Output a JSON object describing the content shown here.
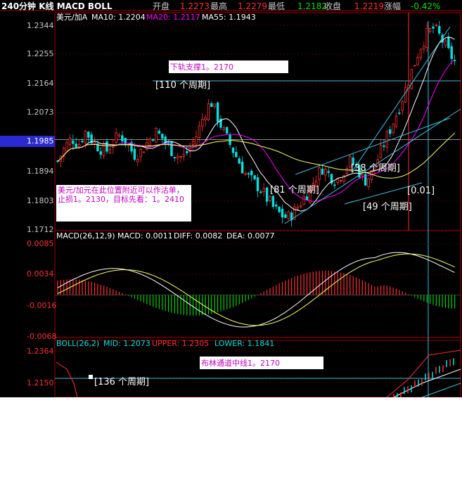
{
  "header": {
    "period": "240分钟",
    "kline_label": "K线",
    "indicators": "MACD BOLL",
    "open_label": "开盘",
    "open_value": "1.2273",
    "high_label": "最高",
    "high_value": "1.2279",
    "low_label": "最低",
    "low_value": "1.2182",
    "close_label": "收盘",
    "close_value": "1.2219",
    "change_label": "涨幅",
    "change_value": "-0.42%"
  },
  "main_panel": {
    "symbol": "美元/加A",
    "ma10": "MA10: 1.2204",
    "ma20": "MA20: 1.2117",
    "ma55": "MA55: 1.1943",
    "price_ticks": [
      "1.2344",
      "1.2255",
      "1.2164",
      "1.2073",
      "1.1985",
      "1.1894",
      "1.1803",
      "1.1712"
    ],
    "current_price": "1.1985",
    "note_support": "下轨支撑1。2170",
    "note_main": "美元/加元在此位置附近可以作沽单，止损1。2130，目标先看：1。2410",
    "labels": [
      "[110 个周期]",
      "[81 个周期]",
      "[38 个周期]",
      "[0.01]",
      "[49 个周期]"
    ]
  },
  "macd_panel": {
    "title": "MACD(26,12,9)",
    "macd": "MACD: 0.0011",
    "diff": "DIFF: 0.0082",
    "dea": "DEA: 0.0077",
    "ticks": [
      "0.0085",
      "0.0034",
      "-0.0016",
      "-0.0068"
    ]
  },
  "boll_panel": {
    "title": "BOLL(26,2)",
    "mid": "MID: 1.2073",
    "upper": "UPPER: 1.2305",
    "lower": "LOWER: 1.1841",
    "ticks": [
      "1.2364",
      "1.2150"
    ],
    "note": "布林通道中线1。2170",
    "label": "[136 个周期]"
  },
  "colors": {
    "up": "#ff3030",
    "down": "#00e0e0",
    "ma10": "#ffffff",
    "ma20": "#ff00ff",
    "ma55": "#ffff60",
    "grid": "#a00000",
    "axis_text": "#c8c8c8",
    "macd_pos": "#ff3030",
    "macd_neg": "#00d000"
  },
  "chart_data": [
    {
      "type": "candlestick",
      "title": "",
      "ylim": [
        1.1712,
        1.2344
      ],
      "series": [
        {
          "name": "美元/加A"
        }
      ],
      "close_trend": [
        1.192,
        1.196,
        1.199,
        1.197,
        1.201,
        1.198,
        1.196,
        1.195,
        1.198,
        1.2,
        1.197,
        1.194,
        1.195,
        1.198,
        1.201,
        1.199,
        1.196,
        1.194,
        1.193,
        1.196,
        1.2,
        1.206,
        1.21,
        1.205,
        1.2,
        1.196,
        1.192,
        1.188,
        1.186,
        1.184,
        1.181,
        1.178,
        1.176,
        1.175,
        1.177,
        1.18,
        1.183,
        1.187,
        1.19,
        1.188,
        1.186,
        1.189,
        1.192,
        1.19,
        1.186,
        1.188,
        1.193,
        1.198,
        1.203,
        1.208,
        1.214,
        1.22,
        1.226,
        1.23,
        1.232,
        1.229,
        1.225,
        1.222
      ],
      "ma10": "1.2204",
      "ma20": "1.2117",
      "ma55": "1.1943"
    },
    {
      "type": "bar",
      "title": "MACD(26,12,9)",
      "ylim": [
        -0.0068,
        0.0085
      ],
      "macd": "0.0011",
      "diff": "0.0082",
      "dea": "0.0077"
    },
    {
      "type": "line",
      "title": "BOLL(26,2)",
      "ylim": [
        1.215,
        1.2364
      ],
      "mid": "1.2073",
      "upper": "1.2305",
      "lower": "1.1841"
    }
  ]
}
